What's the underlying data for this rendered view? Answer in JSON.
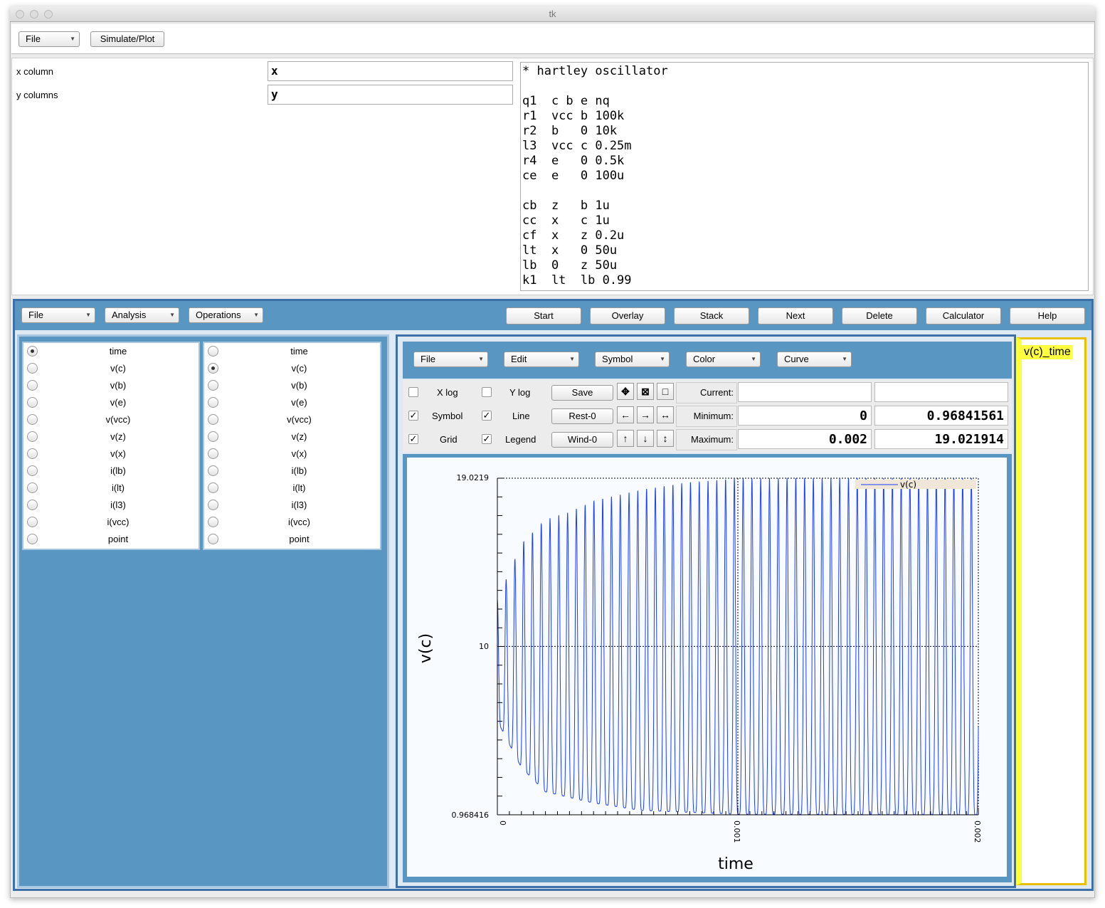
{
  "window": {
    "title": "tk"
  },
  "top_menu": {
    "file": "File",
    "simulate": "Simulate/Plot"
  },
  "columns": {
    "x_label": "x column",
    "x_value": "x",
    "y_label": "y columns",
    "y_value": "y"
  },
  "netlist": "* hartley oscillator\n\nq1  c b e nq\nr1  vcc b 100k\nr2  b   0 10k\nl3  vcc c 0.25m\nr4  e   0 0.5k\nce  e   0 100u\n\ncb  z   b 1u\ncc  x   c 1u\ncf  x   z 0.2u\nlt  x   0 50u\nlb  0   z 50u\nk1  lt  lb 0.99",
  "toolbar": {
    "menus": [
      "File",
      "Analysis",
      "Operations"
    ],
    "buttons": [
      "Start",
      "Overlay",
      "Stack",
      "Next",
      "Delete",
      "Calculator",
      "Help"
    ]
  },
  "x_list": {
    "items": [
      "time",
      "v(c)",
      "v(b)",
      "v(e)",
      "v(vcc)",
      "v(z)",
      "v(x)",
      "i(lb)",
      "i(lt)",
      "i(l3)",
      "i(vcc)",
      "point"
    ],
    "selected": 0
  },
  "y_list": {
    "items": [
      "time",
      "v(c)",
      "v(b)",
      "v(e)",
      "v(vcc)",
      "v(z)",
      "v(x)",
      "i(lb)",
      "i(lt)",
      "i(l3)",
      "i(vcc)",
      "point"
    ],
    "selected": 1
  },
  "plot_menu": [
    "File",
    "Edit",
    "Symbol",
    "Color",
    "Curve"
  ],
  "options": {
    "xlog": {
      "label": "X log",
      "checked": false
    },
    "ylog": {
      "label": "Y log",
      "checked": false
    },
    "symbol": {
      "label": "Symbol",
      "checked": true
    },
    "line": {
      "label": "Line",
      "checked": true
    },
    "grid": {
      "label": "Grid",
      "checked": true
    },
    "legend": {
      "label": "Legend",
      "checked": true
    }
  },
  "actions": {
    "save": "Save",
    "rest": "Rest-0",
    "wind": "Wind-0"
  },
  "icons": [
    "zoom-fit-icon",
    "zoom-cross-icon",
    "square-icon",
    "arrow-left-icon",
    "arrow-right-icon",
    "arrow-horizontal-icon",
    "arrow-up-icon",
    "arrow-down-icon",
    "arrow-vertical-icon"
  ],
  "readout": {
    "current_label": "Current:",
    "current_x": "",
    "current_y": "",
    "min_label": "Minimum:",
    "min_x": "0",
    "min_y": "0.96841561",
    "max_label": "Maximum:",
    "max_x": "0.002",
    "max_y": "19.021914"
  },
  "curves": {
    "items": [
      "v(c)_time"
    ],
    "highlight": "#ffff40"
  },
  "chart_data": {
    "type": "line",
    "xlabel": "time",
    "ylabel": "v(c)",
    "xlim": [
      0,
      0.002
    ],
    "ylim": [
      0.968416,
      19.0219
    ],
    "xticks": [
      "0",
      "0.001",
      "0.002"
    ],
    "yticks": [
      "0.968416",
      "10",
      "19.0219"
    ],
    "grid": true,
    "legend_position": "top-right",
    "series": [
      {
        "name": "v(c)",
        "color": "#1a3cff",
        "description_period_s": 3.65e-05,
        "peak_envelope": {
          "x": [
            0,
            0.0001,
            0.0002,
            0.0003,
            0.0004,
            0.0005,
            0.0006,
            0.0007,
            0.0008,
            0.001,
            0.0012,
            0.002
          ],
          "y": [
            12.5,
            15.5,
            16.8,
            17.2,
            17.8,
            18.1,
            18.4,
            18.6,
            18.8,
            19.0,
            19.02,
            19.02
          ]
        },
        "trough_envelope": {
          "x": [
            0,
            0.0001,
            0.0002,
            0.0004,
            0.0006,
            0.001,
            0.002
          ],
          "y": [
            6,
            3.5,
            2.2,
            1.6,
            1.2,
            1.0,
            0.97
          ]
        }
      }
    ]
  }
}
